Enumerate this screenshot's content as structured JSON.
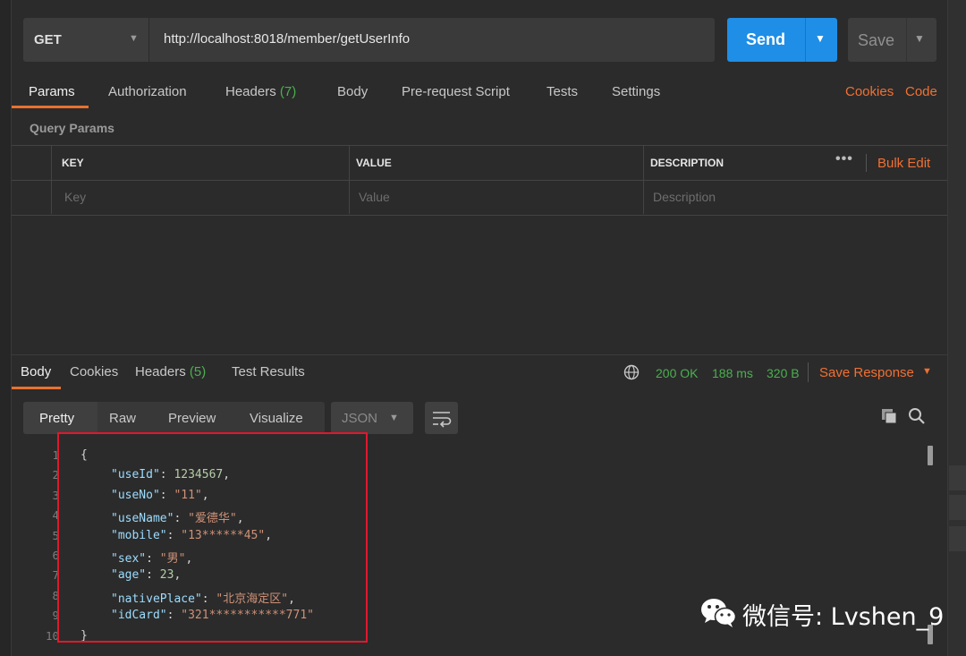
{
  "request": {
    "method": "GET",
    "url": "http://localhost:8018/member/getUserInfo",
    "send_label": "Send",
    "save_label": "Save"
  },
  "request_tabs": {
    "params": "Params",
    "authorization": "Authorization",
    "headers": "Headers",
    "headers_count": "(7)",
    "body": "Body",
    "pre_request": "Pre-request Script",
    "tests": "Tests",
    "settings": "Settings",
    "cookies": "Cookies",
    "code": "Code"
  },
  "query_params": {
    "title": "Query Params",
    "columns": [
      "KEY",
      "VALUE",
      "DESCRIPTION"
    ],
    "placeholders": [
      "Key",
      "Value",
      "Description"
    ],
    "more": "•••",
    "bulk_edit": "Bulk Edit"
  },
  "response_tabs": {
    "body": "Body",
    "cookies": "Cookies",
    "headers": "Headers",
    "headers_count": "(5)",
    "test_results": "Test Results"
  },
  "response_status": {
    "status": "200 OK",
    "time": "188 ms",
    "size": "320 B",
    "save_response": "Save Response"
  },
  "view_modes": [
    "Pretty",
    "Raw",
    "Preview",
    "Visualize"
  ],
  "format": "JSON",
  "code": {
    "line_numbers": [
      "1",
      "2",
      "3",
      "4",
      "5",
      "6",
      "7",
      "8",
      "9",
      "10"
    ],
    "open_brace": "{",
    "close_brace": "}",
    "fields": [
      {
        "key": "\"useId\"",
        "value": "1234567",
        "type": "number",
        "sep": ","
      },
      {
        "key": "\"useNo\"",
        "value": "\"11\"",
        "type": "string",
        "sep": ","
      },
      {
        "key": "\"useName\"",
        "value": "\"爱德华\"",
        "type": "string",
        "sep": ","
      },
      {
        "key": "\"mobile\"",
        "value": "\"13******45\"",
        "type": "string",
        "sep": ","
      },
      {
        "key": "\"sex\"",
        "value": "\"男\"",
        "type": "string",
        "sep": ","
      },
      {
        "key": "\"age\"",
        "value": "23",
        "type": "number",
        "sep": ","
      },
      {
        "key": "\"nativePlace\"",
        "value": "\"北京海定区\"",
        "type": "string",
        "sep": ","
      },
      {
        "key": "\"idCard\"",
        "value": "\"321***********771\"",
        "type": "string",
        "sep": ""
      }
    ]
  },
  "watermark": {
    "text": "微信号: Lvshen_9"
  },
  "colors": {
    "accent_orange": "#f07033",
    "send_blue": "#1f8ee6",
    "status_green": "#4caf50",
    "highlight_red": "#e0182d"
  }
}
